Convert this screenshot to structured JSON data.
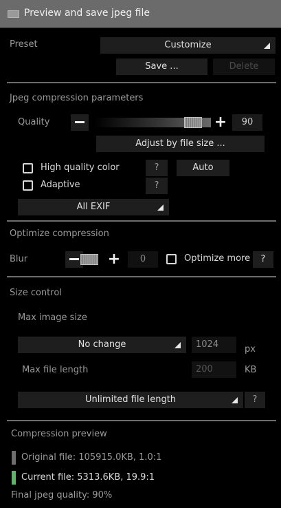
{
  "title": "Preview and save jpeg file",
  "preset": {
    "label": "Preset",
    "value": "Customize",
    "save": "Save ...",
    "delete": "Delete"
  },
  "jpeg": {
    "section": "Jpeg compression parameters",
    "quality_label": "Quality",
    "quality_value": "90",
    "quality_level": 0.9,
    "adjust": "Adjust by file size ...",
    "high_quality_color": "High quality color",
    "help": "?",
    "auto": "Auto",
    "adaptive": "Adaptive",
    "exif": "All EXIF"
  },
  "optimize": {
    "section": "Optimize compression",
    "blur_label": "Blur",
    "blur_value": "0",
    "optimize_more": "Optimize more",
    "help": "?"
  },
  "size": {
    "section": "Size control",
    "max_image_size": "Max image size",
    "no_change": "No change",
    "px_value": "1024",
    "px_unit": "px",
    "max_file_length": "Max file length",
    "kb_value": "200",
    "kb_unit": "KB",
    "unlimited": "Unlimited file length",
    "help": "?"
  },
  "preview": {
    "section": "Compression preview",
    "original": "Original file: 105915.0KB, 1.0:1",
    "current": "Current file: 5313.6KB, 19.9:1",
    "final": "Final jpeg quality: 90%",
    "original_color": "#6e6e6e",
    "current_color": "#5fb36a"
  }
}
